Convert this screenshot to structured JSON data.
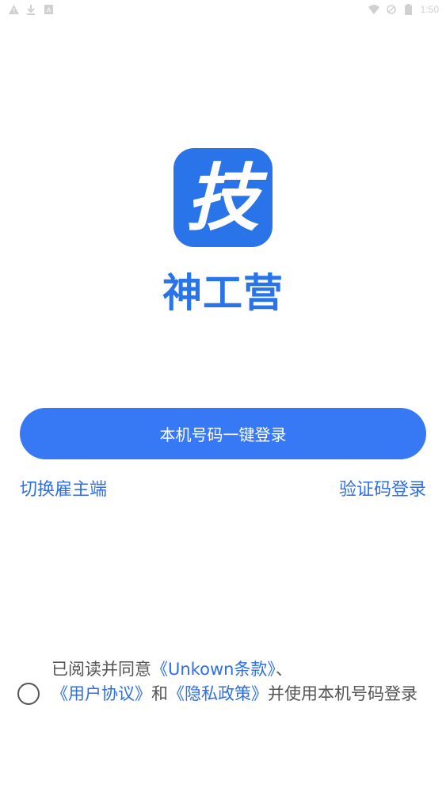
{
  "status_bar": {
    "left_icons": [
      "warning-icon",
      "download-icon",
      "notification-icon"
    ],
    "right_icons": [
      "wifi-icon",
      "no-signal-icon",
      "battery-icon"
    ],
    "time": "1:50"
  },
  "app": {
    "logo_char": "技",
    "name": "神工营"
  },
  "actions": {
    "one_click_login": "本机号码一键登录",
    "switch_employer": "切换雇主端",
    "sms_login": "验证码登录"
  },
  "agreement": {
    "prefix": "已阅读并同意",
    "terms": "《Unkown条款》",
    "sep1": "、",
    "user_agreement": "《用户协议》",
    "and": "和",
    "privacy_policy": "《隐私政策》",
    "suffix": "并使用本机号码登录"
  },
  "colors": {
    "brand": "#2a74ea",
    "button": "#3778f5",
    "link": "#2d6fe8"
  }
}
